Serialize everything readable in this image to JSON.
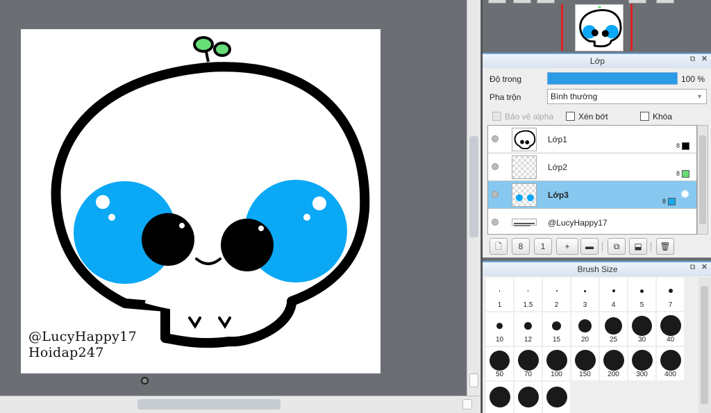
{
  "canvas": {
    "watermark_line1": "@LucyHappy17",
    "watermark_line2": "Hoidap247"
  },
  "layer_panel": {
    "title": "Lớp",
    "opacity_label": "Độ trong",
    "opacity_value": "100 %",
    "opacity_fraction": 1.0,
    "blend_label": "Pha trộn",
    "blend_mode": "Bình thường",
    "protect_alpha_label": "Bảo vệ alpha",
    "clipping_label": "Xén bớt",
    "lock_label": "Khóa",
    "layers": [
      {
        "name": "Lớp1",
        "bits": "8",
        "color": "#000000",
        "selected": false
      },
      {
        "name": "Lớp2",
        "bits": "8",
        "color": "#66dd77",
        "selected": false
      },
      {
        "name": "Lớp3",
        "bits": "8",
        "color": "#1aa9f0",
        "selected": true
      },
      {
        "name": "@LucyHappy17",
        "bits": "",
        "color": "",
        "selected": false
      }
    ],
    "toolbar_icons": [
      "new-layer-icon",
      "new-8bit-layer-icon",
      "new-1bit-layer-icon",
      "add-special-layer-icon",
      "folder-icon",
      "duplicate-layer-icon",
      "merge-down-icon",
      "delete-layer-icon"
    ],
    "toolbar_glyphs": [
      "🗋",
      "8",
      "1",
      "+",
      "▬",
      "⧉",
      "⬓",
      "🗑"
    ]
  },
  "brush_panel": {
    "title": "Brush Size",
    "sizes": [
      "1",
      "1.5",
      "2",
      "3",
      "4",
      "5",
      "7",
      "10",
      "12",
      "15",
      "20",
      "25",
      "30",
      "40",
      "50",
      "70",
      "100",
      "150",
      "200",
      "300",
      "400",
      "",
      "",
      ""
    ]
  },
  "colors": {
    "eye_blue": "#0aa8f5",
    "leaf_green": "#66dd77",
    "accent": "#6fa8dc"
  }
}
